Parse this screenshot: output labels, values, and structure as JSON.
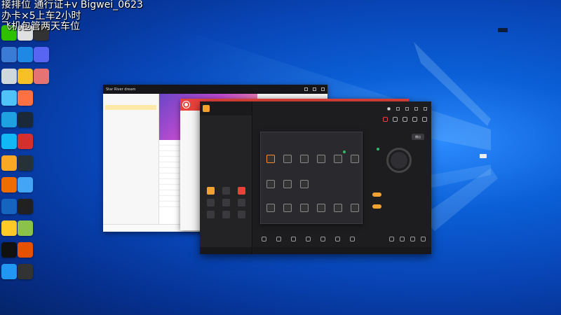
{
  "overlay": {
    "line1": "接排位 通行证+v  Bigwei_0623",
    "line2": "办卡×5上车2小时",
    "line3": "飞机包管两天车位"
  },
  "colors": {
    "wallpaper": "#0b5fd6",
    "accent_orange": "#f2a230",
    "app_red": "#e8423b",
    "dark_bg": "#1d1d20"
  },
  "desktop_icons": [
    {
      "name": "app-icon-wechat",
      "color": "#2dc100",
      "col": 0,
      "row": 0
    },
    {
      "name": "app-icon-doc",
      "color": "#e0e0e0",
      "col": 1,
      "row": 0
    },
    {
      "name": "app-icon-media",
      "color": "#333333",
      "col": 2,
      "row": 0
    },
    {
      "name": "app-icon-game",
      "color": "#3a7bd5",
      "col": 0,
      "row": 1
    },
    {
      "name": "app-icon-monitor",
      "color": "#1e88e5",
      "col": 1,
      "row": 1
    },
    {
      "name": "app-icon-discord",
      "color": "#5865f2",
      "col": 2,
      "row": 1
    },
    {
      "name": "app-icon-recycle",
      "color": "#cfd8dc",
      "col": 0,
      "row": 2
    },
    {
      "name": "app-icon-notes",
      "color": "#f6c026",
      "col": 1,
      "row": 2
    },
    {
      "name": "app-icon-anime",
      "color": "#e57373",
      "col": 2,
      "row": 2
    },
    {
      "name": "app-icon-pc",
      "color": "#4fc3f7",
      "col": 0,
      "row": 3
    },
    {
      "name": "app-icon-orange",
      "color": "#ff7043",
      "col": 1,
      "row": 3
    },
    {
      "name": "app-icon-edge",
      "color": "#1fa0e0",
      "col": 0,
      "row": 4
    },
    {
      "name": "app-icon-steam",
      "color": "#1b2838",
      "col": 1,
      "row": 4
    },
    {
      "name": "app-icon-qq",
      "color": "#12b7f5",
      "col": 0,
      "row": 5
    },
    {
      "name": "app-icon-adobe",
      "color": "#d32f2f",
      "col": 1,
      "row": 5
    },
    {
      "name": "app-icon-folder",
      "color": "#f9a825",
      "col": 0,
      "row": 6
    },
    {
      "name": "app-icon-tool",
      "color": "#263238",
      "col": 1,
      "row": 6
    },
    {
      "name": "app-icon-torch",
      "color": "#ef6c00",
      "col": 0,
      "row": 7
    },
    {
      "name": "app-icon-screen",
      "color": "#42a5f5",
      "col": 1,
      "row": 7
    },
    {
      "name": "app-icon-browser",
      "color": "#1565c0",
      "col": 0,
      "row": 8
    },
    {
      "name": "app-icon-dark",
      "color": "#212121",
      "col": 1,
      "row": 8
    },
    {
      "name": "app-icon-owl",
      "color": "#ffca28",
      "col": 0,
      "row": 9
    },
    {
      "name": "app-icon-green",
      "color": "#8bc34a",
      "col": 1,
      "row": 9
    },
    {
      "name": "app-icon-black",
      "color": "#111111",
      "col": 0,
      "row": 10
    },
    {
      "name": "app-icon-game2",
      "color": "#e65100",
      "col": 1,
      "row": 10
    },
    {
      "name": "app-icon-shield",
      "color": "#2196f3",
      "col": 0,
      "row": 11
    },
    {
      "name": "app-icon-ring",
      "color": "#333333",
      "col": 1,
      "row": 11
    }
  ],
  "win1": {
    "title": "Star River dream"
  },
  "win3": {
    "start_label": "播出"
  }
}
